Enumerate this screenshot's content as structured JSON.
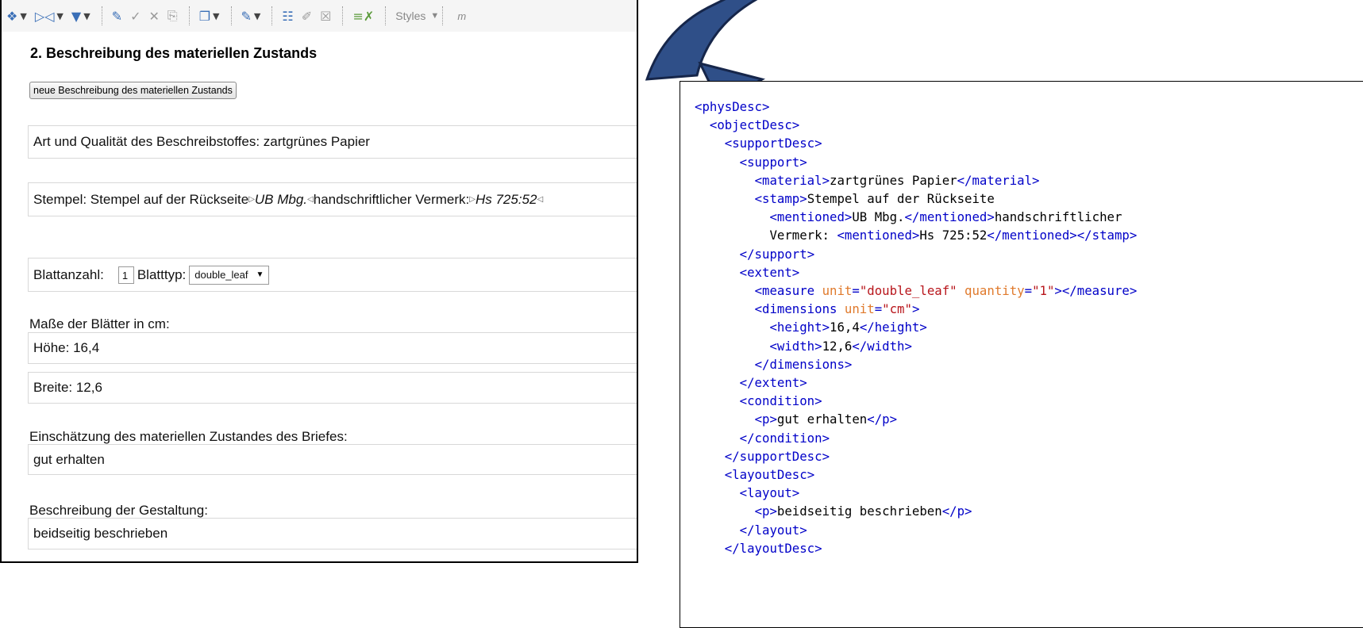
{
  "toolbar": {
    "items": [
      {
        "icon": "tag-insert-icon",
        "glyph": "❖",
        "dropdown": true
      },
      {
        "icon": "tag-move-icon",
        "glyph": "▷◁",
        "dropdown": true
      },
      {
        "icon": "filter-icon",
        "glyph": "▼",
        "dropdown": true
      },
      {
        "icon": "highlight-icon",
        "glyph": "✎"
      },
      {
        "icon": "accept-icon",
        "glyph": "✓"
      },
      {
        "icon": "reject-icon",
        "glyph": "✕"
      },
      {
        "icon": "track-changes-icon",
        "glyph": "⎘"
      },
      {
        "icon": "copy-icon",
        "glyph": "❐",
        "dropdown": true
      },
      {
        "icon": "marker-icon",
        "glyph": "✎",
        "dropdown": true
      },
      {
        "icon": "comment-add-icon",
        "glyph": "☷"
      },
      {
        "icon": "comment-edit-icon",
        "glyph": "✐"
      },
      {
        "icon": "comment-remove-icon",
        "glyph": "☒"
      },
      {
        "icon": "spellcheck-icon",
        "glyph": "≡✗"
      }
    ],
    "styles_label": "Styles",
    "m_label": "m"
  },
  "form": {
    "section_title": "2. Beschreibung des materiellen Zustands",
    "new_button": "neue Beschreibung des materiellen Zustands",
    "material": "Art und Qualität des Beschreibstoffes: zartgrünes Papier",
    "stamp": {
      "prefix": "Stempel: Stempel auf der Rückseite",
      "mention1": "UB Mbg.",
      "middle": "handschriftlicher Vermerk: ",
      "mention2": "Hs 725:52"
    },
    "leaf_count_label": "Blattanzahl:",
    "leaf_count_value": "1",
    "leaf_type_label": "Blatttyp:",
    "leaf_type_value": "double_leaf",
    "dimensions_label": "Maße der Blätter in cm:",
    "height": "Höhe: 16,4",
    "width": "Breite: 12,6",
    "condition_label": "Einschätzung des materiellen Zustandes des Briefes:",
    "condition_value": "gut erhalten",
    "layout_label": "Beschreibung der Gestaltung:",
    "layout_value": "beidseitig beschrieben"
  },
  "xml": {
    "lines": [
      "<physDesc>",
      "  <objectDesc>",
      "    <supportDesc>",
      "      <support>",
      "        <material>zartgrünes Papier</material>",
      "        <stamp>Stempel auf der Rückseite",
      "          <mentioned>UB Mbg.</mentioned>handschriftlicher",
      "          Vermerk: <mentioned>Hs 725:52</mentioned></stamp>",
      "      </support>",
      "      <extent>",
      "        <measure unit=\"double_leaf\" quantity=\"1\"></measure>",
      "        <dimensions unit=\"cm\">",
      "          <height>16,4</height>",
      "          <width>12,6</width>",
      "        </dimensions>",
      "      </extent>",
      "      <condition>",
      "        <p>gut erhalten</p>",
      "      </condition>",
      "    </supportDesc>",
      "    <layoutDesc>",
      "      <layout>",
      "        <p>beidseitig beschrieben</p>",
      "      </layout>",
      "    </layoutDesc>"
    ]
  },
  "colors": {
    "tag": "#0000c8",
    "attr": "#e07a2c",
    "value": "#b8151b",
    "arrow_fill": "#2f4f88",
    "arrow_stroke": "#16264a"
  }
}
